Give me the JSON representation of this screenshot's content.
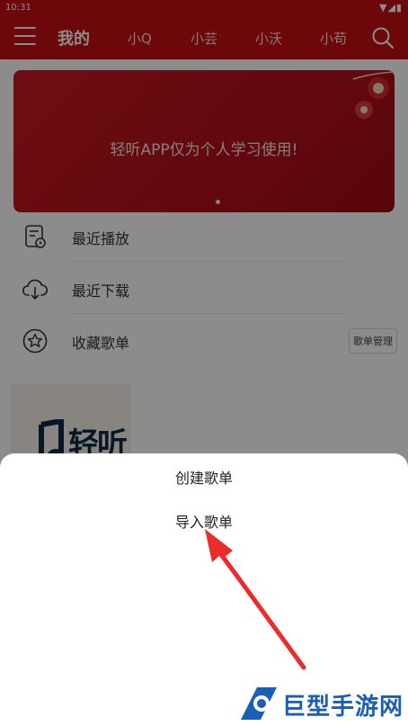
{
  "status_bar": {
    "time": "10:31",
    "icons": "▼◢▮"
  },
  "header": {
    "tabs": [
      {
        "label": "我的",
        "active": true
      },
      {
        "label": "小Q",
        "active": false
      },
      {
        "label": "小芸",
        "active": false
      },
      {
        "label": "小沃",
        "active": false
      },
      {
        "label": "小苟",
        "active": false
      }
    ],
    "menu_icon": "hamburger-menu-icon",
    "search_icon": "search-icon"
  },
  "banner": {
    "text": "轻听APP仅为个人学习使用!"
  },
  "menu_list": [
    {
      "label": "最近播放",
      "icon": "recent-play-icon"
    },
    {
      "label": "最近下载",
      "icon": "cloud-download-icon"
    },
    {
      "label": "收藏歌单",
      "icon": "star-icon",
      "action": "歌单管理"
    }
  ],
  "playlist_cover": {
    "logo_text": "轻听"
  },
  "bottom_sheet": {
    "items": [
      {
        "label": "创建歌单"
      },
      {
        "label": "导入歌单"
      }
    ]
  },
  "watermark": {
    "text": "巨型手游网"
  },
  "colors": {
    "header_red": "#c50f12",
    "arrow_red": "#ee2b2b",
    "watermark_blue": "#1a5fb4"
  }
}
